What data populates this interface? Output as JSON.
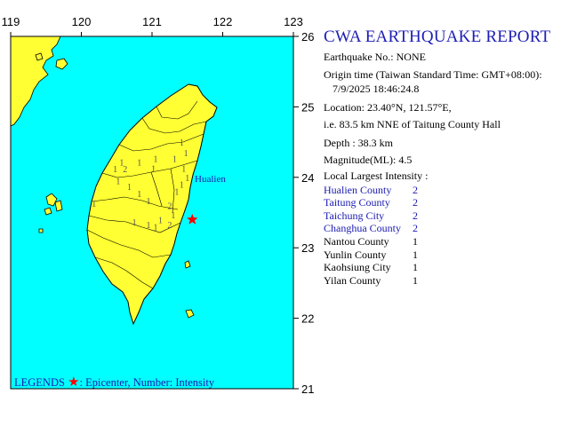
{
  "report": {
    "title": "CWA EARTHQUAKE REPORT",
    "earthquake_no": "Earthquake No.: NONE",
    "origin_label": "Origin time (Taiwan Standard Time: GMT+08:00):",
    "origin_time": "7/9/2025 18:46:24.8",
    "location": "Location: 23.40°N, 121.57°E,",
    "relative": "i.e. 83.5 km NNE of Taitung County Hall",
    "depth": "Depth : 38.3 km",
    "magnitude": "Magnitude(ML): 4.5",
    "intensity_heading": "Local Largest Intensity :",
    "intensities": [
      {
        "name": "Hualien County",
        "value": "2",
        "color": "#1a1ab0"
      },
      {
        "name": "Taitung County",
        "value": "2",
        "color": "#1a1ab0"
      },
      {
        "name": "Taichung City",
        "value": "2",
        "color": "#1a1ab0"
      },
      {
        "name": "Changhua County",
        "value": "2",
        "color": "#1a1ab0"
      },
      {
        "name": "Nantou County",
        "value": "1",
        "color": "#000000"
      },
      {
        "name": "Yunlin County",
        "value": "1",
        "color": "#000000"
      },
      {
        "name": "Kaohsiung City",
        "value": "1",
        "color": "#000000"
      },
      {
        "name": "Yilan County",
        "value": "1",
        "color": "#000000"
      }
    ]
  },
  "map": {
    "lon_ticks": [
      "119",
      "120",
      "121",
      "122",
      "123"
    ],
    "lat_ticks": [
      "26",
      "25",
      "24",
      "23",
      "22",
      "21"
    ],
    "lon_range": [
      119,
      123
    ],
    "lat_range": [
      21,
      26
    ],
    "sea_color": "#00ffff",
    "land_color": "#ffff33",
    "city_label": "Hualien",
    "epicenter": {
      "lon": 121.57,
      "lat": 23.4,
      "color": "#ff0000"
    },
    "station_intensities": [
      {
        "lon": 121.42,
        "lat": 24.45,
        "value": "1"
      },
      {
        "lon": 121.48,
        "lat": 24.3,
        "value": "1"
      },
      {
        "lon": 121.32,
        "lat": 24.22,
        "value": "1"
      },
      {
        "lon": 121.45,
        "lat": 24.08,
        "value": "1"
      },
      {
        "lon": 121.5,
        "lat": 23.95,
        "value": "1"
      },
      {
        "lon": 121.42,
        "lat": 23.85,
        "value": "1"
      },
      {
        "lon": 121.35,
        "lat": 23.75,
        "value": "1"
      },
      {
        "lon": 121.25,
        "lat": 23.55,
        "value": "2"
      },
      {
        "lon": 121.3,
        "lat": 23.42,
        "value": "1"
      },
      {
        "lon": 121.25,
        "lat": 23.28,
        "value": "2"
      },
      {
        "lon": 121.05,
        "lat": 24.22,
        "value": "1"
      },
      {
        "lon": 121.02,
        "lat": 24.08,
        "value": "1"
      },
      {
        "lon": 120.82,
        "lat": 24.17,
        "value": "1"
      },
      {
        "lon": 120.57,
        "lat": 24.17,
        "value": "1"
      },
      {
        "lon": 120.62,
        "lat": 24.07,
        "value": "2"
      },
      {
        "lon": 120.48,
        "lat": 24.07,
        "value": "1"
      },
      {
        "lon": 120.52,
        "lat": 23.9,
        "value": "1"
      },
      {
        "lon": 120.68,
        "lat": 23.82,
        "value": "1"
      },
      {
        "lon": 120.82,
        "lat": 23.72,
        "value": "1"
      },
      {
        "lon": 120.95,
        "lat": 23.62,
        "value": "1"
      },
      {
        "lon": 120.18,
        "lat": 23.58,
        "value": "1"
      },
      {
        "lon": 120.75,
        "lat": 23.32,
        "value": "1"
      },
      {
        "lon": 120.95,
        "lat": 23.28,
        "value": "1"
      },
      {
        "lon": 121.05,
        "lat": 23.25,
        "value": "1"
      },
      {
        "lon": 121.12,
        "lat": 23.35,
        "value": "1"
      }
    ]
  },
  "legend": {
    "prefix": "LEGENDS",
    "text": ": Epicenter, Number: Intensity"
  }
}
